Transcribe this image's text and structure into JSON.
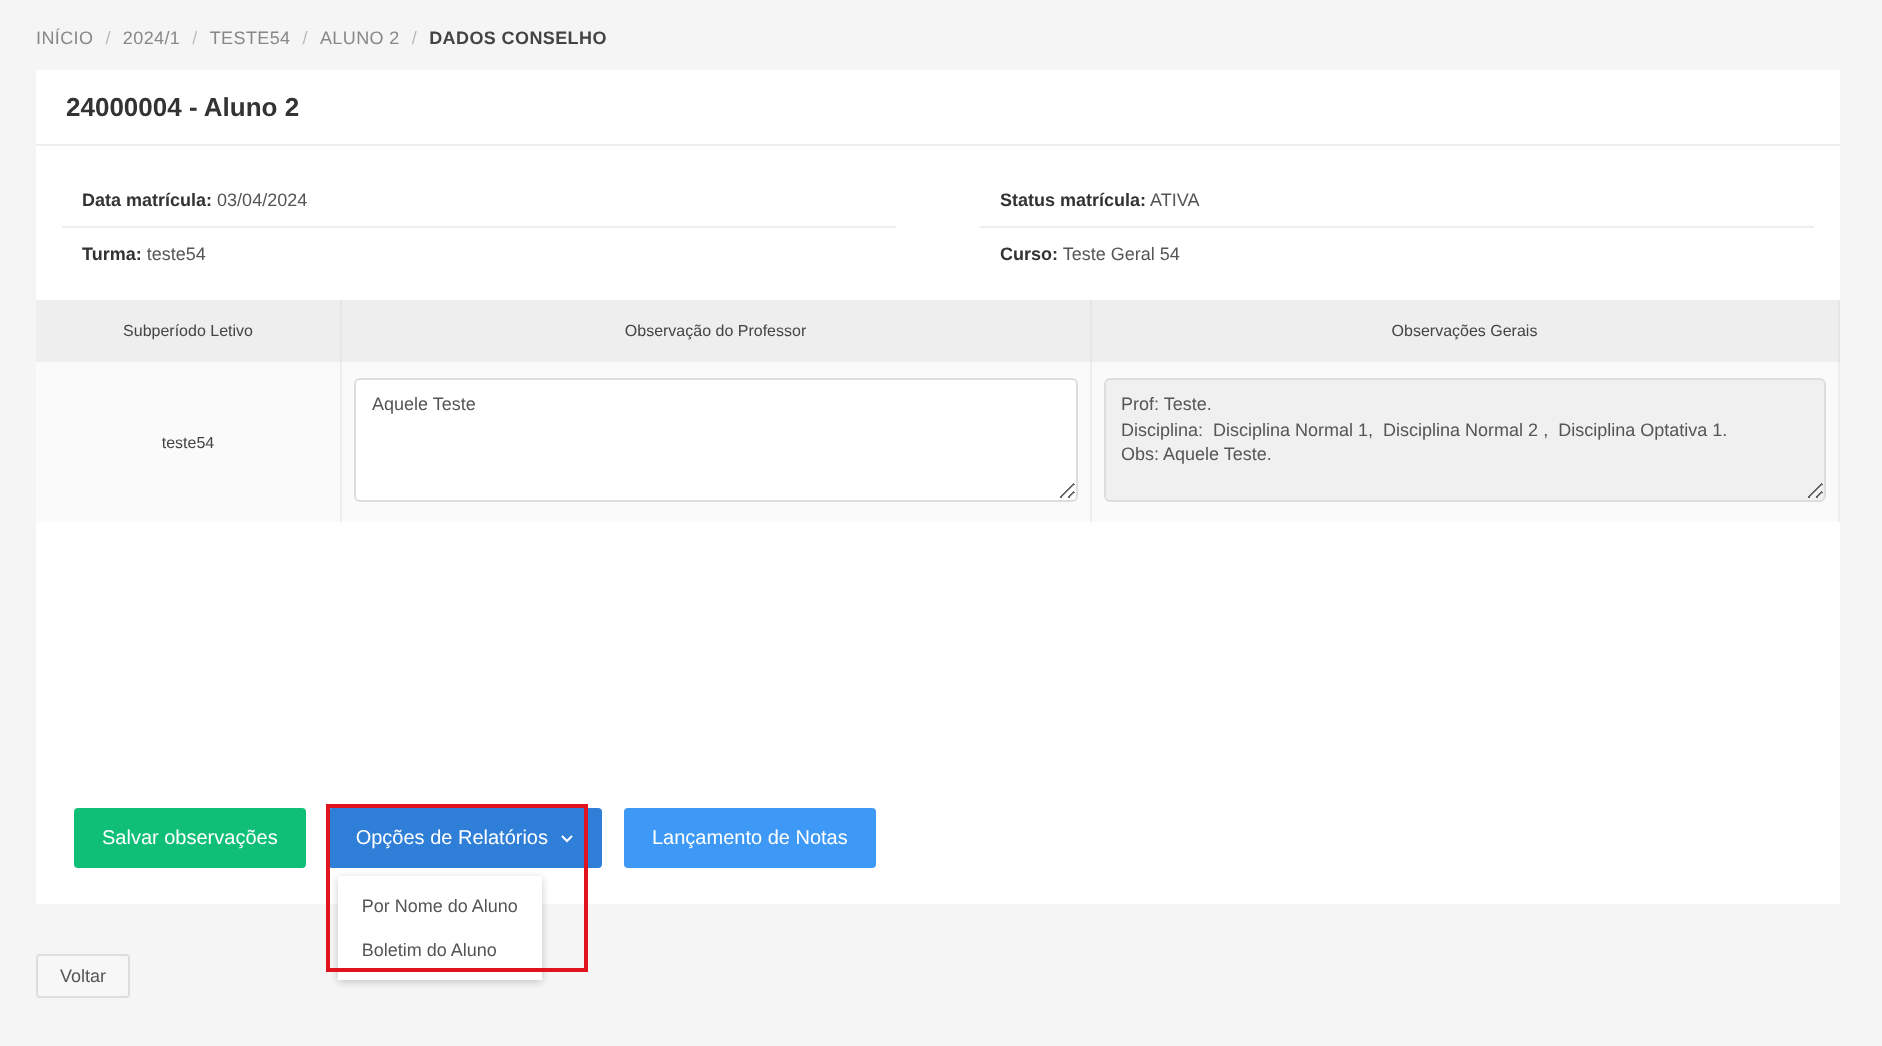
{
  "breadcrumb": {
    "separator": "/",
    "items": [
      {
        "label": "INÍCIO",
        "selected": false
      },
      {
        "label": "2024/1",
        "selected": false
      },
      {
        "label": "TESTE54",
        "selected": false
      },
      {
        "label": "ALUNO 2",
        "selected": false
      },
      {
        "label": "DADOS CONSELHO",
        "selected": true
      }
    ]
  },
  "card": {
    "title": "24000004 - Aluno 2",
    "info": [
      [
        {
          "label": "Data matrícula:",
          "value": "03/04/2024"
        },
        {
          "label": "Turma:",
          "value": "teste54"
        }
      ],
      [
        {
          "label": "Status matrícula:",
          "value": "ATIVA"
        },
        {
          "label": "Curso:",
          "value": "Teste Geral 54"
        }
      ]
    ],
    "table": {
      "columns": [
        "Subperíodo Letivo",
        "Observação do Professor",
        "Observações Gerais"
      ],
      "rows": [
        {
          "subperiod": "teste54",
          "teacher_note": {
            "value": "Aquele Teste",
            "readonly": false
          },
          "general_notes": {
            "value": "Prof: Teste.\nDisciplina:  Disciplina Normal 1,  Disciplina Normal 2 ,  Disciplina Optativa 1.\nObs: Aquele Teste.",
            "readonly": true
          }
        }
      ]
    },
    "buttons": [
      {
        "label": "Salvar observações",
        "kind": "success"
      },
      {
        "label": "Opções de Relatórios",
        "kind": "dropdown",
        "expanded": true,
        "highlighted": true,
        "menu": [
          "Por Nome do Aluno",
          "Boletim do Aluno"
        ]
      },
      {
        "label": "Lançamento de Notas",
        "kind": "primary"
      }
    ]
  },
  "back_button": "Voltar"
}
